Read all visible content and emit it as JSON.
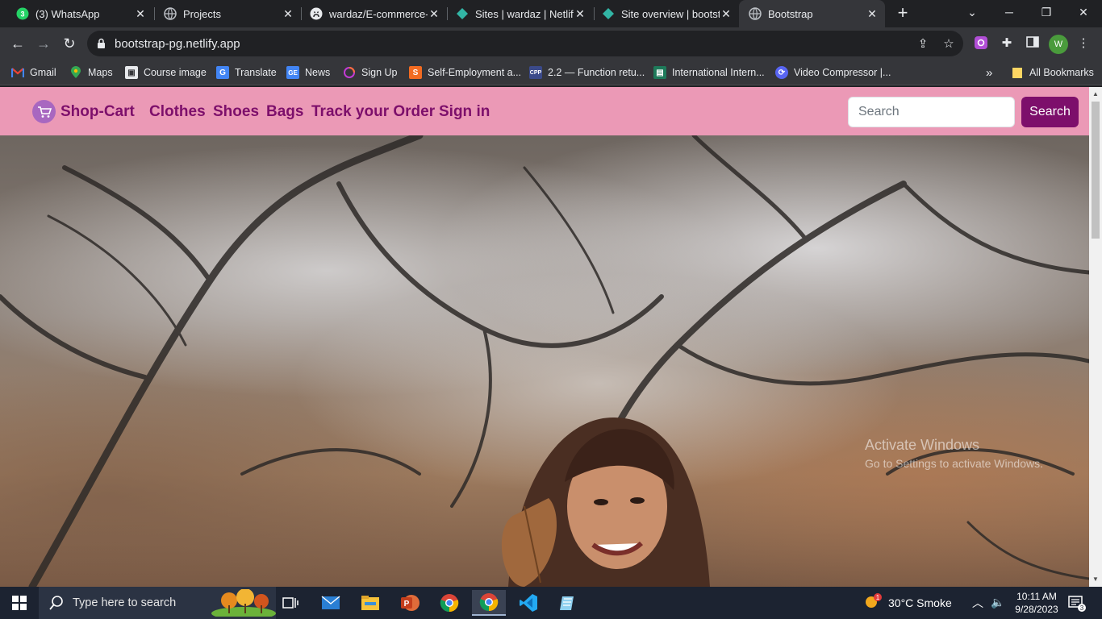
{
  "browser": {
    "tabs": [
      {
        "title": "(3) WhatsApp",
        "favicon": "whatsapp-icon",
        "badge": "3"
      },
      {
        "title": "Projects",
        "favicon": "globe-icon"
      },
      {
        "title": "wardaz/E-commerce-",
        "favicon": "github-icon"
      },
      {
        "title": "Sites | wardaz | Netlify",
        "favicon": "netlify-icon"
      },
      {
        "title": "Site overview | bootst",
        "favicon": "netlify-icon"
      },
      {
        "title": "Bootstrap",
        "favicon": "globe-icon",
        "active": true
      }
    ],
    "url": "bootstrap-pg.netlify.app",
    "profile_initial": "W",
    "bookmarks": [
      {
        "label": "Gmail",
        "icon": "gmail-icon"
      },
      {
        "label": "Maps",
        "icon": "maps-icon"
      },
      {
        "label": "Course image",
        "icon": "image-icon"
      },
      {
        "label": "Translate",
        "icon": "translate-icon"
      },
      {
        "label": "News",
        "icon": "news-icon"
      },
      {
        "label": "Sign Up",
        "icon": "ring-icon"
      },
      {
        "label": "Self-Employment a...",
        "icon": "s-icon"
      },
      {
        "label": "2.2 — Function retu...",
        "icon": "cpp-icon"
      },
      {
        "label": "International Intern...",
        "icon": "book-icon"
      },
      {
        "label": "Video Compressor |...",
        "icon": "compress-icon"
      }
    ],
    "bookmarks_overflow": "»",
    "all_bookmarks": "All Bookmarks"
  },
  "site": {
    "brand": "Shop-Cart",
    "nav": [
      "Clothes",
      "Shoes",
      "Bags",
      "Track your Order",
      "Sign in"
    ],
    "search_placeholder": "Search",
    "search_button": "Search"
  },
  "watermark": {
    "line1": "Activate Windows",
    "line2": "Go to Settings to activate Windows."
  },
  "taskbar": {
    "search_placeholder": "Type here to search",
    "weather": "30°C  Smoke",
    "weather_badge": "1",
    "time": "10:11 AM",
    "date": "9/28/2023",
    "notification_count": "3"
  },
  "colors": {
    "navbar_bg": "#eb99b6",
    "brand_purple": "#7d0f6b",
    "browser_dark": "#202124",
    "toolbar": "#35363a"
  }
}
